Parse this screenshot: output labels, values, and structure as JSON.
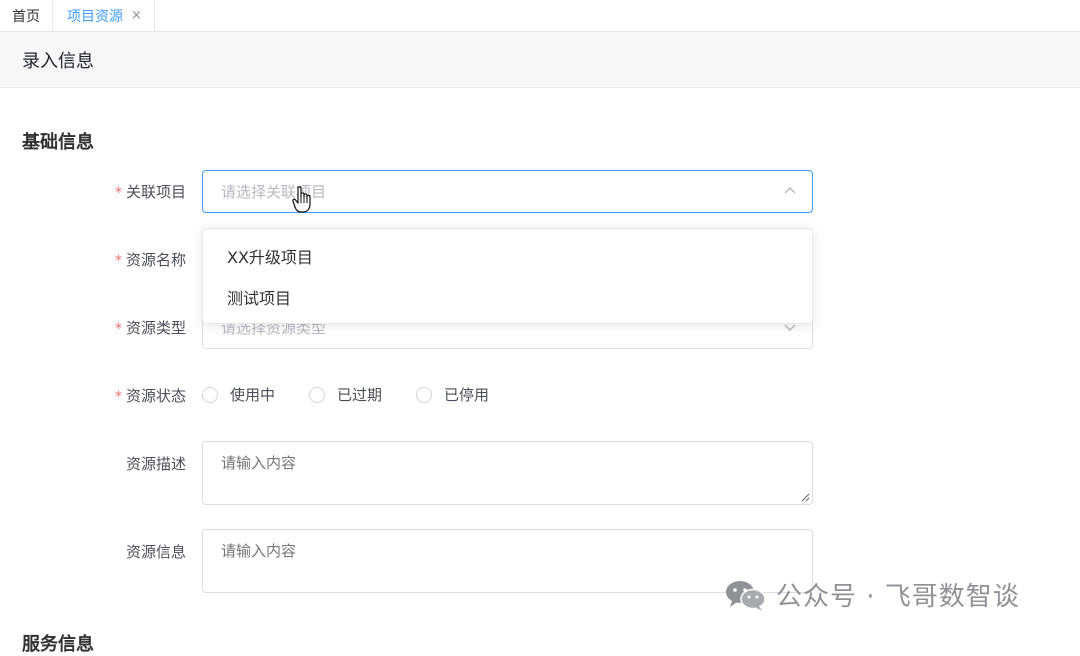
{
  "tabs": [
    {
      "label": "首页"
    },
    {
      "label": "项目资源",
      "close": "×"
    }
  ],
  "page_title": "录入信息",
  "section_title": "基础信息",
  "form": {
    "project": {
      "label": "关联项目",
      "placeholder": "请选择关联项目",
      "required": "*"
    },
    "name": {
      "label": "资源名称",
      "required": "*"
    },
    "type": {
      "label": "资源类型",
      "placeholder": "请选择资源类型",
      "required": "*"
    },
    "status": {
      "label": "资源状态",
      "required": "*",
      "options": [
        "使用中",
        "已过期",
        "已停用"
      ]
    },
    "description": {
      "label": "资源描述",
      "placeholder": "请输入内容"
    },
    "info": {
      "label": "资源信息",
      "placeholder": "请输入内容"
    }
  },
  "dropdown": {
    "options": [
      "XX升级项目",
      "测试项目"
    ]
  },
  "watermark": {
    "text": "公众号 · 飞哥数智谈"
  },
  "next_section_partial": "服务信息",
  "colors": {
    "accent": "#409eff",
    "required": "#f56c6c"
  }
}
